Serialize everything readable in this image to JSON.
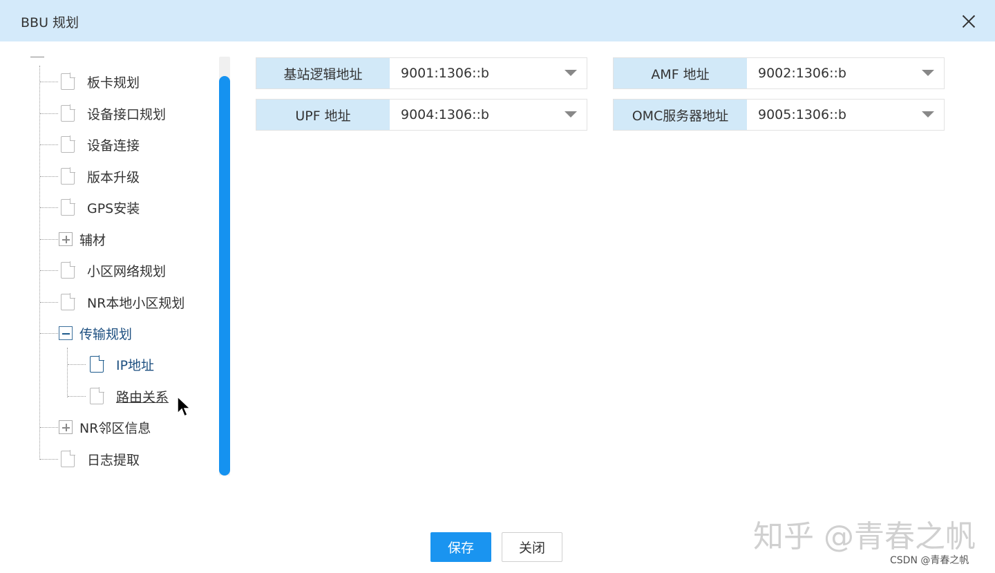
{
  "dialog": {
    "title": "BBU 规划"
  },
  "tree": {
    "items": [
      {
        "label": "板卡规划"
      },
      {
        "label": "设备接口规划"
      },
      {
        "label": "设备连接"
      },
      {
        "label": "版本升级"
      },
      {
        "label": "GPS安装"
      },
      {
        "label": "辅材"
      },
      {
        "label": "小区网络规划"
      },
      {
        "label": "NR本地小区规划"
      },
      {
        "label": "传输规划"
      },
      {
        "label": "IP地址"
      },
      {
        "label": "路由关系"
      },
      {
        "label": "NR邻区信息"
      },
      {
        "label": "日志提取"
      }
    ]
  },
  "form": {
    "fields": [
      {
        "label": "基站逻辑地址",
        "value": "9001:1306::b"
      },
      {
        "label": "AMF 地址",
        "value": "9002:1306::b"
      },
      {
        "label": "UPF 地址",
        "value": "9004:1306::b"
      },
      {
        "label": "OMC服务器地址",
        "value": "9005:1306::b"
      }
    ]
  },
  "buttons": {
    "save": "保存",
    "close": "关闭"
  },
  "watermark": {
    "main": "知乎 @青春之帆",
    "csdn": "CSDN @青春之帆"
  },
  "colors": {
    "titlebar": "#d4eafa",
    "accent": "#1a94f0",
    "label_bg": "#d2e9f8",
    "tree_active": "#1d4f80"
  }
}
